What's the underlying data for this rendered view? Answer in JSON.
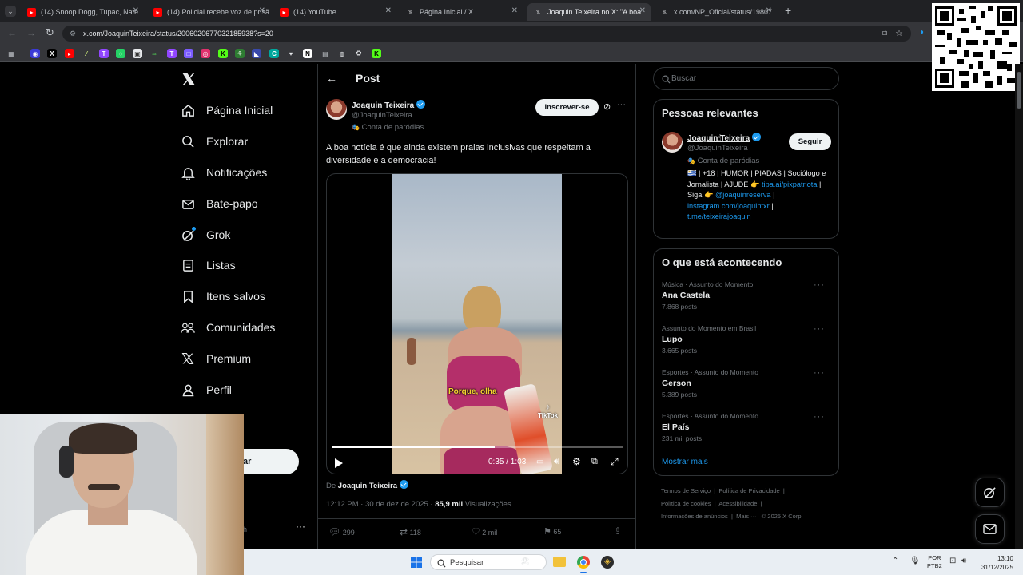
{
  "browser": {
    "tabs": [
      {
        "title": "(14) Snoop Dogg, Tupac, Nate",
        "favicon": "youtube-icon"
      },
      {
        "title": "(14) Policial recebe voz de prisã",
        "favicon": "youtube-icon"
      },
      {
        "title": "(14) YouTube",
        "favicon": "youtube-icon"
      },
      {
        "title": "Página Inicial / X",
        "favicon": "x-icon"
      },
      {
        "title": "Joaquin Teixeira no X: \"A boa n",
        "favicon": "x-icon"
      },
      {
        "title": "x.com/NP_Oficial/status/19807",
        "favicon": "x-icon"
      }
    ],
    "url": "x.com/JoaquinTeixeira/status/2006020677032185938?s=20"
  },
  "nav": {
    "items": [
      {
        "label": "Página Inicial",
        "icon": "home-icon"
      },
      {
        "label": "Explorar",
        "icon": "search-icon"
      },
      {
        "label": "Notificações",
        "icon": "bell-icon"
      },
      {
        "label": "Bate-papo",
        "icon": "mail-icon"
      },
      {
        "label": "Grok",
        "icon": "grok-icon"
      },
      {
        "label": "Listas",
        "icon": "list-icon"
      },
      {
        "label": "Itens salvos",
        "icon": "bookmark-icon"
      },
      {
        "label": "Comunidades",
        "icon": "communities-icon"
      },
      {
        "label": "Premium",
        "icon": "x-icon"
      },
      {
        "label": "Perfil",
        "icon": "person-icon"
      }
    ],
    "post_button_partial": "ar",
    "account_partial": "h"
  },
  "post": {
    "header_title": "Post",
    "author_name": "Joaquin Teixeira",
    "author_handle": "@JoaquinTeixeira",
    "parody_label": "Conta de paródias",
    "subscribe_label": "Inscrever-se",
    "text": "A boa notícia é que ainda existem praias inclusivas que respeitam a diversidade e a democracia!",
    "video": {
      "caption": "Porque, olha",
      "watermark": "TikTok",
      "time": "0:35 / 1:03",
      "progress": 0.56
    },
    "from_label": "De",
    "from_name": "Joaquin Teixeira",
    "timestamp": "12:12 PM · 30 de dez de 2025 ·",
    "views_count": "85,9 mil",
    "views_label": "Visualizações",
    "actions": {
      "replies": "299",
      "reposts": "118",
      "likes": "2 mil",
      "bookmarks": "65"
    }
  },
  "sidebar": {
    "search_placeholder": "Buscar",
    "relevant_title": "Pessoas relevantes",
    "person": {
      "name": "Joaquin Teixeira",
      "handle": "@JoaquinTeixeira",
      "parody_label": "Conta de paródias",
      "follow_label": "Seguir",
      "bio_line1": "🇺🇾 | +18 | HUMOR | PIADAS | Sociólogo e Jornalista | AJUDE 👉",
      "bio_link1": "tipa.ai/pixpatriota",
      "bio_mid": " | Siga 👉",
      "bio_link2": "@joaquinreserva",
      "bio_link3": "instagram.com/joaquintxr",
      "bio_link4": "t.me/teixeirajoaquin"
    },
    "trends_title": "O que está acontecendo",
    "trends": [
      {
        "category": "Música · Assunto do Momento",
        "name": "Ana Castela",
        "count": "7.868 posts"
      },
      {
        "category": "Assunto do Momento em Brasil",
        "name": "Lupo",
        "count": "3.665 posts"
      },
      {
        "category": "Esportes · Assunto do Momento",
        "name": "Gerson",
        "count": "5.389 posts"
      },
      {
        "category": "Esportes · Assunto do Momento",
        "name": "El País",
        "count": "231 mil posts"
      }
    ],
    "show_more": "Mostrar mais",
    "footer": {
      "line1": [
        "Termos de Serviço",
        "Política de Privacidade"
      ],
      "line2": [
        "Política de cookies",
        "Acessibilidade"
      ],
      "line3": [
        "Informações de anúncios",
        "Mais ···",
        "© 2025 X Corp."
      ]
    }
  },
  "taskbar": {
    "search_placeholder": "Pesquisar",
    "lang_top": "POR",
    "lang_bottom": "PTB2",
    "time": "13:10",
    "date": "31/12/2025"
  },
  "colors": {
    "accent": "#1d9bf0",
    "background": "#000000",
    "border": "#2f3336",
    "muted": "#71767b"
  }
}
